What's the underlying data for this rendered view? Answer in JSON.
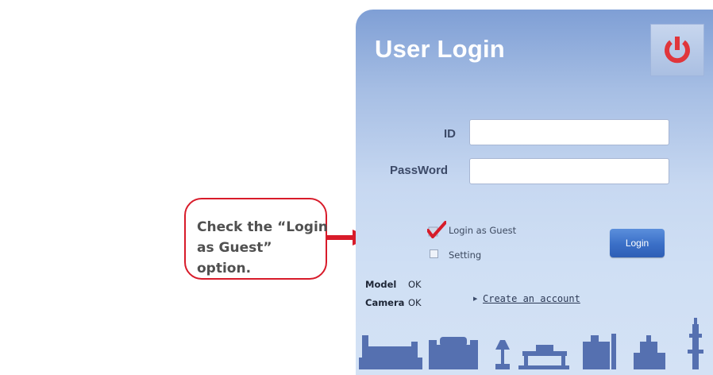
{
  "callout": {
    "line1": "Check the “Login as Guest”",
    "line2": "option."
  },
  "login": {
    "title": "User Login",
    "id_label": "ID",
    "password_label": "PassWord",
    "id_value": "",
    "password_value": "",
    "guest_option": {
      "label": "Login as Guest",
      "checked": true
    },
    "setting_option": {
      "label": "Setting",
      "checked": false
    },
    "login_button": "Login",
    "power_icon": "power-icon"
  },
  "status": {
    "model_label": "Model",
    "model_value": "OK",
    "camera_label": "Camera",
    "camera_value": "OK"
  },
  "create_account": "Create an account",
  "colors": {
    "callout_border": "#d81b2a",
    "power_red": "#e0353b",
    "login_blue": "#3a6fc7",
    "check_red": "#d71c2a",
    "skyline": "#5570b0"
  }
}
